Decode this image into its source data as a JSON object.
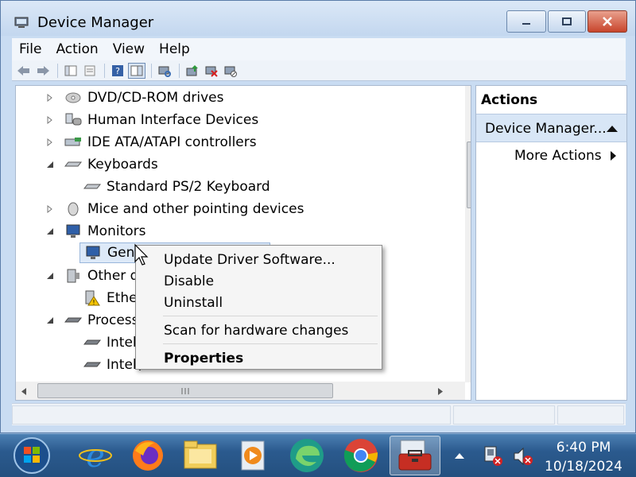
{
  "window": {
    "title": "Device Manager",
    "buttons": {
      "minimize": "minimize",
      "maximize": "maximize",
      "close": "close"
    }
  },
  "menu": [
    "File",
    "Action",
    "View",
    "Help"
  ],
  "tree": {
    "items": [
      {
        "label": "DVD/CD-ROM drives",
        "expanded": false,
        "icon": "dvd-drive-icon"
      },
      {
        "label": "Human Interface Devices",
        "expanded": false,
        "icon": "hid-icon"
      },
      {
        "label": "IDE ATA/ATAPI controllers",
        "expanded": false,
        "icon": "ide-controller-icon"
      },
      {
        "label": "Keyboards",
        "expanded": true,
        "icon": "keyboard-icon"
      },
      {
        "label": "Standard PS/2 Keyboard",
        "child": true,
        "icon": "keyboard-icon"
      },
      {
        "label": "Mice and other pointing devices",
        "expanded": false,
        "icon": "mouse-icon"
      },
      {
        "label": "Monitors",
        "expanded": true,
        "icon": "monitor-icon"
      },
      {
        "label": "Gene",
        "child": true,
        "icon": "monitor-icon",
        "selected": true
      },
      {
        "label": "Other de",
        "expanded": true,
        "icon": "other-device-icon"
      },
      {
        "label": "Ether",
        "child": true,
        "icon": "unknown-device-warning-icon"
      },
      {
        "label": "Processo",
        "expanded": true,
        "icon": "processor-icon"
      },
      {
        "label": "Intel(",
        "child": true,
        "icon": "processor-icon"
      },
      {
        "label": "Intel(",
        "child": true,
        "icon": "processor-icon"
      }
    ]
  },
  "actions": {
    "header": "Actions",
    "section": "Device Manager...",
    "more": "More Actions"
  },
  "context_menu": {
    "items": [
      {
        "label": "Update Driver Software...",
        "bold": false
      },
      {
        "label": "Disable",
        "bold": false
      },
      {
        "label": "Uninstall",
        "bold": false
      },
      {
        "label": "Scan for hardware changes",
        "bold": false
      },
      {
        "label": "Properties",
        "bold": true
      }
    ]
  },
  "taskbar": {
    "apps": [
      "start-orb-icon",
      "internet-explorer-icon",
      "firefox-icon",
      "file-explorer-icon",
      "media-player-icon",
      "edge-icon",
      "chrome-icon",
      "toolbox-icon"
    ],
    "time": "6:40 PM",
    "date": "10/18/2024"
  },
  "colors": {
    "titlebar": "#c9dcf2",
    "close_button": "#c8452c",
    "selection": "#dde9f8",
    "taskbar": "#2b5a8e"
  }
}
